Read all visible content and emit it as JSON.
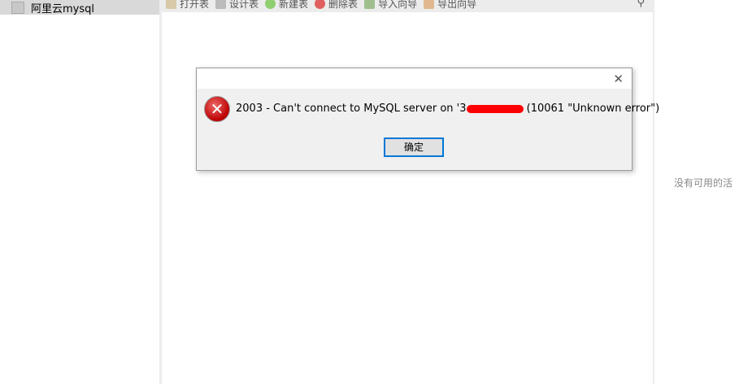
{
  "sidebar": {
    "connection": "阿里云mysql"
  },
  "toolbar": {
    "items": [
      {
        "label": "打开表",
        "color": "#d8c9a8"
      },
      {
        "label": "设计表",
        "color": "#bbbbbb"
      },
      {
        "label": "新建表",
        "color": "#8fcf6f"
      },
      {
        "label": "删除表",
        "color": "#e06060"
      },
      {
        "label": "导入向导",
        "color": "#9fbf8f"
      },
      {
        "label": "导出向导",
        "color": "#e0b890"
      }
    ],
    "search_icon": "search-icon"
  },
  "right_panel": {
    "text": "没有可用的活"
  },
  "dialog": {
    "message_prefix": "2003 - Can't connect to MySQL server on '3",
    "message_suffix": " (10061 \"Unknown error\")",
    "ok_label": "确定",
    "icon": "error-icon",
    "close_icon": "close-icon"
  }
}
